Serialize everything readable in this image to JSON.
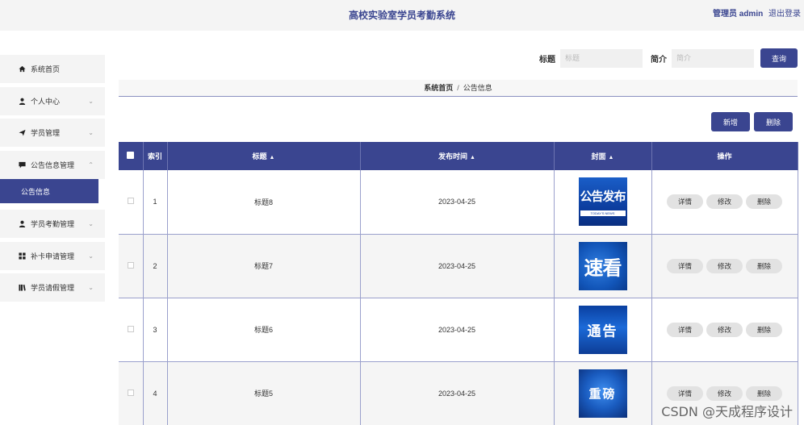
{
  "header": {
    "title": "高校实验室学员考勤系统",
    "user_label": "管理员 admin",
    "logout_label": "退出登录"
  },
  "sidebar": {
    "items": [
      {
        "label": "系统首页",
        "icon": "home-icon",
        "expandable": false
      },
      {
        "label": "个人中心",
        "icon": "user-icon",
        "expandable": true,
        "expanded": false
      },
      {
        "label": "学员管理",
        "icon": "send-icon",
        "expandable": true,
        "expanded": false
      },
      {
        "label": "公告信息管理",
        "icon": "message-icon",
        "expandable": true,
        "expanded": true,
        "children": [
          {
            "label": "公告信息",
            "active": true
          }
        ]
      },
      {
        "label": "学员考勤管理",
        "icon": "user-icon",
        "expandable": true,
        "expanded": false
      },
      {
        "label": "补卡申请管理",
        "icon": "grid-icon",
        "expandable": true,
        "expanded": false
      },
      {
        "label": "学员请假管理",
        "icon": "book-icon",
        "expandable": true,
        "expanded": false
      }
    ]
  },
  "search": {
    "title_label": "标题",
    "title_placeholder": "标题",
    "title_value": "",
    "summary_label": "简介",
    "summary_placeholder": "简介",
    "summary_value": "",
    "button_label": "查询"
  },
  "breadcrumb": {
    "home": "系统首页",
    "separator": "/",
    "current": "公告信息"
  },
  "actions": {
    "add_label": "新增",
    "delete_label": "删除"
  },
  "table": {
    "columns": [
      "",
      "索引",
      "标题",
      "发布时间",
      "封面",
      "操作"
    ],
    "sortable": [
      false,
      false,
      true,
      true,
      true,
      false
    ],
    "rows": [
      {
        "index": "1",
        "title": "标题8",
        "date": "2023-04-25",
        "cover_text": "公告发布",
        "cover_sub": "TODAY'S NEWS"
      },
      {
        "index": "2",
        "title": "标题7",
        "date": "2023-04-25",
        "cover_text": "速看",
        "cover_sub": ""
      },
      {
        "index": "3",
        "title": "标题6",
        "date": "2023-04-25",
        "cover_text": "通告",
        "cover_sub": ""
      },
      {
        "index": "4",
        "title": "标题5",
        "date": "2023-04-25",
        "cover_text": "重磅",
        "cover_sub": ""
      }
    ],
    "row_actions": [
      "详情",
      "修改",
      "删除"
    ]
  },
  "watermark": "CSDN @天成程序设计",
  "colors": {
    "primary": "#3a4590",
    "sidebar_bg": "#f4f4f4",
    "pill_bg": "#e2e2e2"
  }
}
